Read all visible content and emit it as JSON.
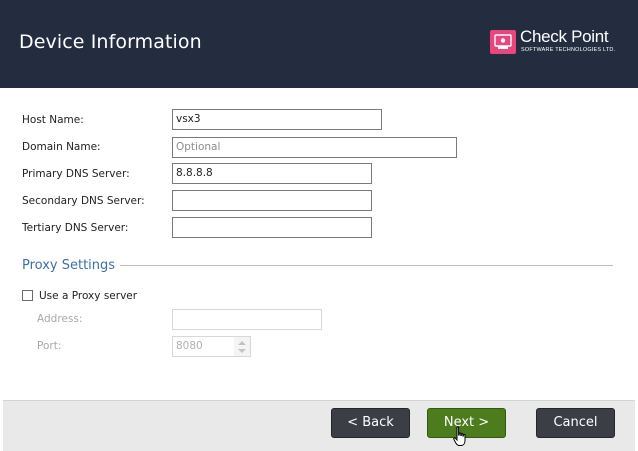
{
  "header": {
    "title": "Device Information",
    "logo_main": "Check Point",
    "logo_sub": "SOFTWARE TECHNOLOGIES LTD."
  },
  "form": {
    "host_name_label": "Host Name:",
    "host_name_value": "vsx3",
    "domain_name_label": "Domain Name:",
    "domain_name_placeholder": "Optional",
    "primary_dns_label": "Primary DNS Server:",
    "primary_dns_value": "8.8.8.8",
    "secondary_dns_label": "Secondary DNS Server:",
    "secondary_dns_value": "",
    "tertiary_dns_label": "Tertiary DNS Server:",
    "tertiary_dns_value": ""
  },
  "proxy": {
    "section_title": "Proxy Settings",
    "use_proxy_label": "Use a Proxy server",
    "use_proxy_checked": false,
    "address_label": "Address:",
    "address_value": "",
    "port_label": "Port:",
    "port_value": "8080"
  },
  "footer": {
    "back_label": "< Back",
    "next_label": "Next >",
    "cancel_label": "Cancel"
  },
  "colors": {
    "header_bg": "#232d3f",
    "brand_pink": "#e8467c",
    "section_blue": "#3d6fa8",
    "next_green": "#4c7c1d",
    "button_dark": "#3b3f45"
  }
}
